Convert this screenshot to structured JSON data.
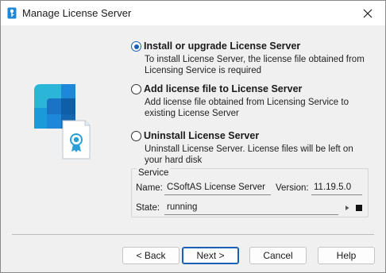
{
  "window": {
    "title": "Manage License Server"
  },
  "options": [
    {
      "label": "Install or upgrade License Server",
      "desc": "To install License Server, the license file obtained from Licensing Service is required",
      "checked": true
    },
    {
      "label": "Add license file to License Server",
      "desc": "Add license file obtained from Licensing Service to existing License Server",
      "checked": false
    },
    {
      "label": "Uninstall License Server",
      "desc": "Uninstall License Server. License files will be left on your hard disk",
      "checked": false
    }
  ],
  "service": {
    "group_title": "Service",
    "name_label": "Name:",
    "name_value": "CSoftAS License Server",
    "version_label": "Version:",
    "version_value": "11.19.5.0",
    "state_label": "State:",
    "state_value": "running"
  },
  "buttons": {
    "back": "< Back",
    "next": "Next >",
    "cancel": "Cancel",
    "help": "Help"
  },
  "icons": {
    "app": "license-key-icon",
    "close": "close-icon",
    "hero": "license-server-icon",
    "start": "play-icon",
    "stop": "stop-icon"
  },
  "colors": {
    "accent": "#1a5fb4",
    "hero_blue": "#1e88d8",
    "hero_teal": "#2bb5d6",
    "certificate_ribbon": "#2a9fd6"
  }
}
